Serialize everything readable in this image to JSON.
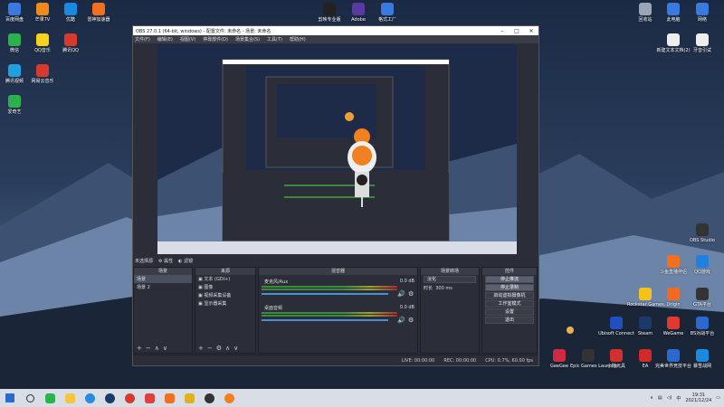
{
  "desktop_left": [
    {
      "label": "百度网盘",
      "color": "#3a7ae0"
    },
    {
      "label": "芒果TV",
      "color": "#f08a1c"
    },
    {
      "label": "优酷",
      "color": "#1a8ae0"
    },
    {
      "label": "雷神加速器",
      "color": "#f07020"
    },
    {
      "label": "微信",
      "color": "#2bb24c"
    },
    {
      "label": "QQ音乐",
      "color": "#f5d21c"
    },
    {
      "label": "腾讯QQ",
      "color": "#d63a2e"
    },
    {
      "label": "腾讯视频",
      "color": "#20a0e0"
    },
    {
      "label": "网易云音乐",
      "color": "#d63a2e"
    },
    {
      "label": "爱奇艺",
      "color": "#2bb24c"
    }
  ],
  "desktop_top": [
    {
      "label": "剪映专业版",
      "color": "#222"
    },
    {
      "label": "Adobe",
      "color": "#5a3aa0"
    },
    {
      "label": "格式工厂",
      "color": "#3a7ae0"
    }
  ],
  "desktop_right": [
    {
      "label": "回收站",
      "color": "#9aa6b8"
    },
    {
      "label": "此电脑",
      "color": "#3a7ae0"
    },
    {
      "label": "网络",
      "color": "#3a7ae0"
    },
    {
      "label": "新建文本文档(2)",
      "color": "#eee"
    },
    {
      "label": "牙音引试",
      "color": "#eee"
    },
    {
      "label": "OBS Studio",
      "color": "#333"
    },
    {
      "label": "斗鱼直播伴侣",
      "color": "#f07020"
    },
    {
      "label": "QQ游戏",
      "color": "#2080e0"
    },
    {
      "label": "Rockstar Games...",
      "color": "#f5c21c"
    },
    {
      "label": "Origin",
      "color": "#f06a20"
    },
    {
      "label": "GTA平台",
      "color": "#333"
    },
    {
      "label": "Ubisoft Connect",
      "color": "#2050c0"
    },
    {
      "label": "Steam",
      "color": "#1a3a6a"
    },
    {
      "label": "WeGame",
      "color": "#e03a2e"
    },
    {
      "label": "BS对战平台",
      "color": "#2a6ad0"
    },
    {
      "label": "GeeGee",
      "color": "#d02a40"
    },
    {
      "label": "Epic Games Launcher",
      "color": "#333"
    },
    {
      "label": "小陆元具",
      "color": "#d0302e"
    },
    {
      "label": "EA",
      "color": "#d02a2a"
    },
    {
      "label": "完美世界竞技平台",
      "color": "#2a6ad0"
    },
    {
      "label": "暴雪战网",
      "color": "#1a8ae0"
    }
  ],
  "obs": {
    "title": "OBS 27.0.1 (64-bit, windows) - 配置文件: 未命名 - 场景: 未命名",
    "menu": [
      "文件(F)",
      "编辑(E)",
      "视图(V)",
      "停靠部件(D)",
      "场景集合(S)",
      "工具(T)",
      "帮助(H)"
    ],
    "status_left": "未选择源",
    "status_props": "属性",
    "status_filters": "滤镜",
    "docks": {
      "scenes": {
        "title": "场景",
        "items": [
          "场景",
          "场景 2"
        ]
      },
      "sources": {
        "title": "来源",
        "items": [
          "文本 (GDI+)",
          "图像",
          "视频采集设备",
          "显示器采集"
        ]
      },
      "mixer": {
        "title": "混音器",
        "channels": [
          {
            "name": "麦克风/Aux",
            "db": "0.0 dB"
          },
          {
            "name": "桌面音频",
            "db": "0.0 dB"
          }
        ]
      },
      "transitions": {
        "title": "场景转场",
        "value": "淡化",
        "duration_label": "时长",
        "duration": "300 ms"
      },
      "controls": {
        "title": "控件",
        "buttons": [
          "停止推流",
          "停止录制",
          "启动虚拟摄像机",
          "工作室模式",
          "设置",
          "退出"
        ]
      }
    },
    "bottom": {
      "live": "LIVE: 00:00:00",
      "rec": "REC: 00:00:00",
      "cpu": "CPU: 0.7%, 60.00 fps"
    }
  },
  "taskbar": {
    "time": "19:31",
    "date": "2021/12/24",
    "lang": "中"
  }
}
